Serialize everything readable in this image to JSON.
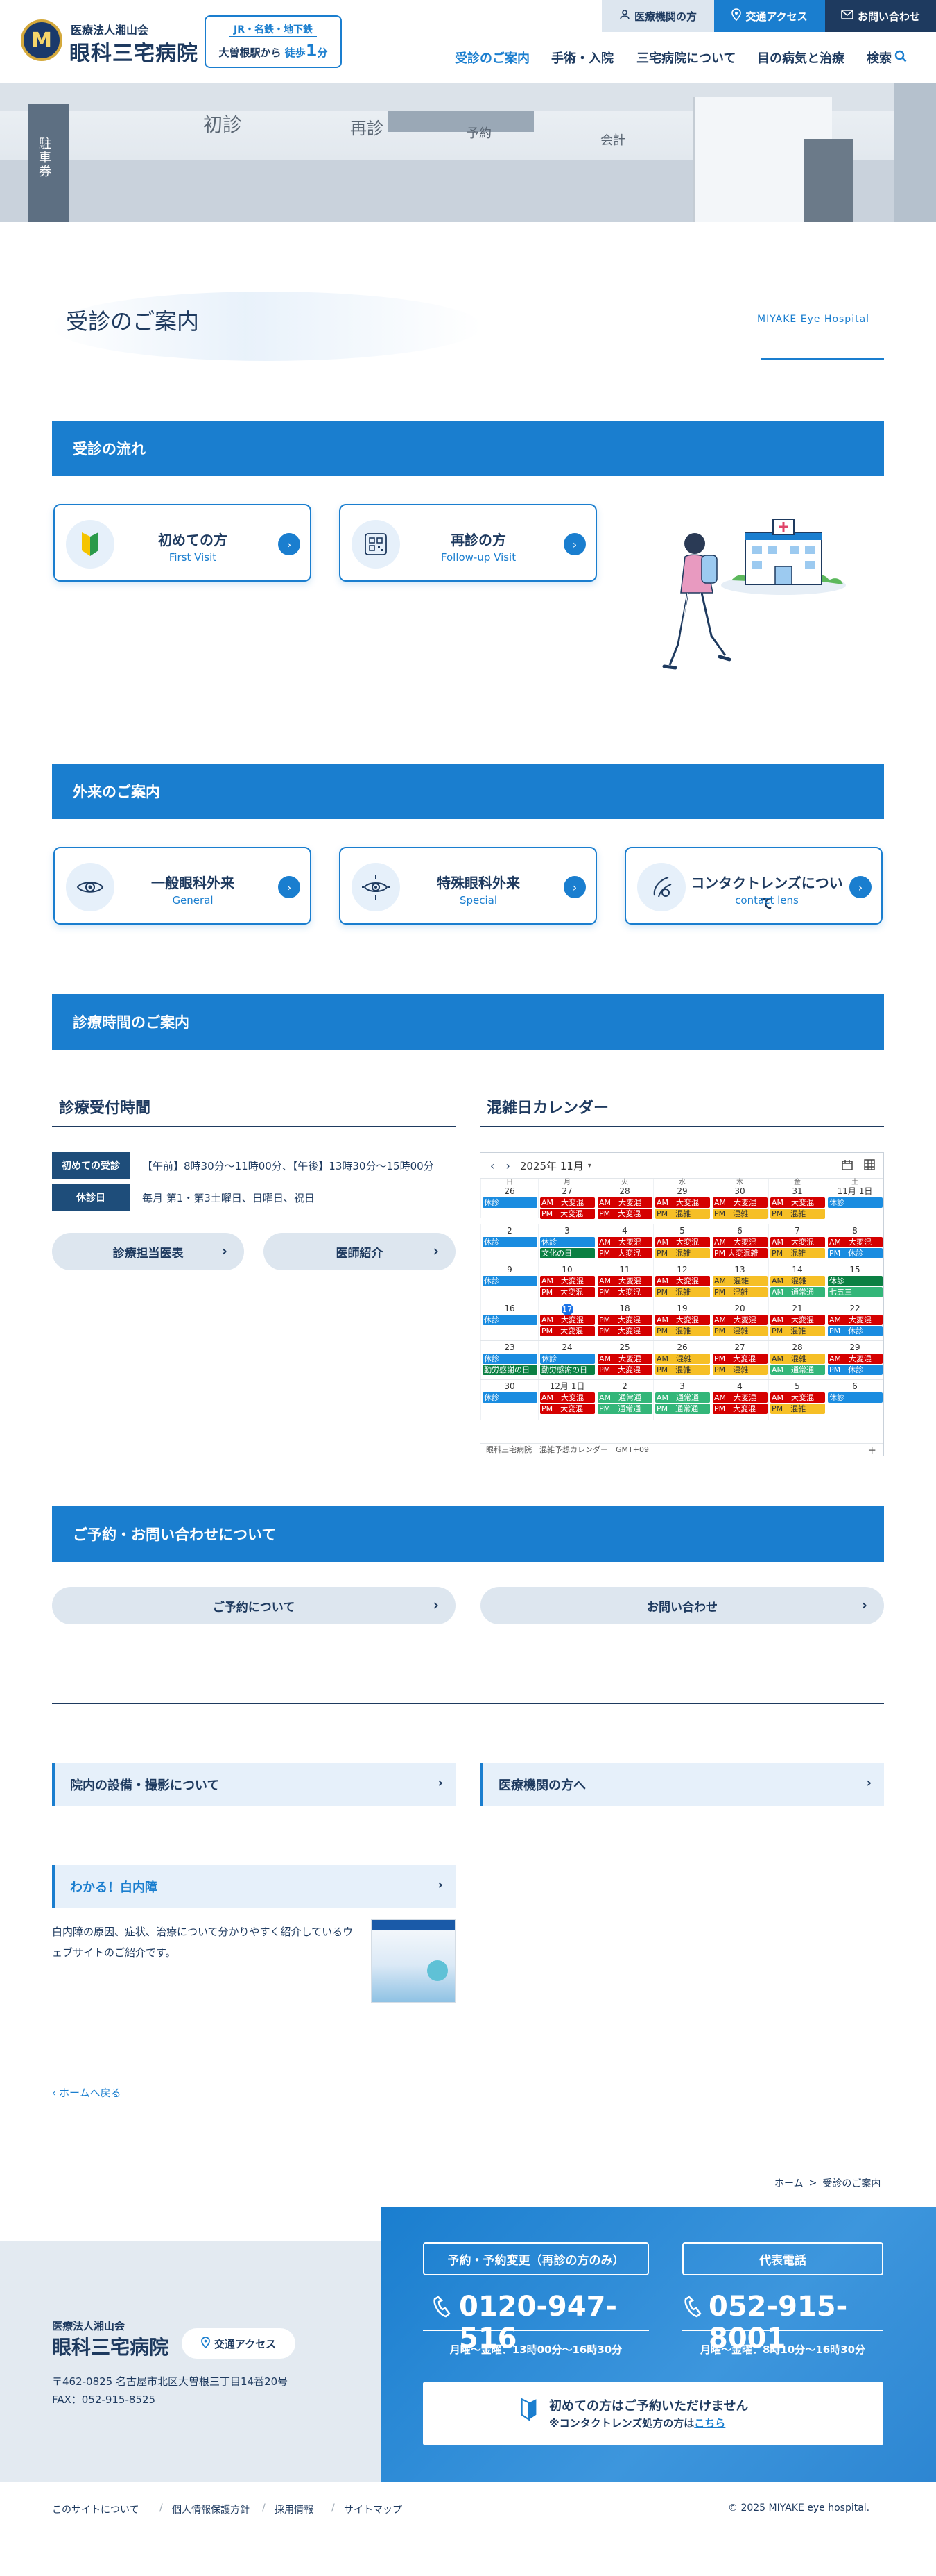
{
  "header": {
    "logo_letter": "M",
    "logo_sub": "医療法人湘山会",
    "logo_main": "眼科三宅病院",
    "access_line1": "JR・名鉄・地下鉄",
    "access_line2_pre": "大曽根駅から",
    "access_line2_walk": "徒歩",
    "access_line2_num": "1",
    "access_line2_unit": "分",
    "top_buttons": [
      "医療機関の方",
      "交通アクセス",
      "お問い合わせ"
    ],
    "nav": [
      "受診のご案内",
      "手術・入院",
      "三宅病院について",
      "目の病気と治療",
      "検索"
    ]
  },
  "hero": {
    "signs": [
      "初診",
      "再診",
      "予約",
      "会計"
    ],
    "board": "駐車券"
  },
  "page": {
    "title": "受診のご案内",
    "title_en": "MIYAKE Eye Hospital"
  },
  "flow": {
    "heading": "受診の流れ",
    "cards": [
      {
        "title": "初めての方",
        "sub": "First Visit"
      },
      {
        "title": "再診の方",
        "sub": "Follow-up Visit"
      }
    ]
  },
  "outpatient": {
    "heading": "外来のご案内",
    "cards": [
      {
        "title": "一般眼科外来",
        "sub": "General"
      },
      {
        "title": "特殊眼科外来",
        "sub": "Special"
      },
      {
        "title": "コンタクトレンズについて",
        "sub": "contact lens"
      }
    ]
  },
  "hours": {
    "heading": "診療時間のご案内",
    "reception_heading": "診療受付時間",
    "calendar_heading": "混雑日カレンダー",
    "rows": [
      {
        "tag": "初めての受診",
        "text": "【午前】8時30分〜11時00分、【午後】13時30分〜15時00分"
      },
      {
        "tag": "休診日",
        "text": "毎月 第1・第3土曜日、日曜日、祝日"
      }
    ],
    "buttons": [
      "診療担当医表",
      "医師紹介"
    ]
  },
  "calendar": {
    "month": "2025年 11月",
    "weekdays": [
      "日",
      "月",
      "火",
      "水",
      "木",
      "金",
      "土"
    ],
    "footer_left": "眼科三宅病院　混雑予想カレンダー　GMT+09",
    "footer_plus": "+",
    "weeks": [
      [
        {
          "d": "26",
          "ev": [
            [
              "blue",
              "休診"
            ]
          ]
        },
        {
          "d": "27",
          "ev": [
            [
              "red",
              "AM　大変混"
            ],
            [
              "red",
              "PM　大変混"
            ]
          ]
        },
        {
          "d": "28",
          "ev": [
            [
              "red",
              "AM　大変混"
            ],
            [
              "red",
              "PM　大変混"
            ]
          ]
        },
        {
          "d": "29",
          "ev": [
            [
              "red",
              "AM　大変混"
            ],
            [
              "yel",
              "PM　混雑"
            ]
          ]
        },
        {
          "d": "30",
          "ev": [
            [
              "red",
              "AM　大変混"
            ],
            [
              "yel",
              "PM　混雑"
            ]
          ]
        },
        {
          "d": "31",
          "ev": [
            [
              "red",
              "AM　大変混"
            ],
            [
              "yel",
              "PM　混雑"
            ]
          ]
        },
        {
          "d": "11月 1日",
          "ev": [
            [
              "blue",
              "休診"
            ]
          ]
        }
      ],
      [
        {
          "d": "2",
          "ev": [
            [
              "blue",
              "休診"
            ]
          ]
        },
        {
          "d": "3",
          "ev": [
            [
              "blue",
              "休診"
            ],
            [
              "grn",
              "文化の日"
            ]
          ]
        },
        {
          "d": "4",
          "ev": [
            [
              "red",
              "AM　大変混"
            ],
            [
              "red",
              "PM　大変混"
            ]
          ]
        },
        {
          "d": "5",
          "ev": [
            [
              "red",
              "AM　大変混"
            ],
            [
              "yel",
              "PM　混雑"
            ]
          ]
        },
        {
          "d": "6",
          "ev": [
            [
              "red",
              "AM　大変混"
            ],
            [
              "red",
              "PM 大変混雑"
            ]
          ]
        },
        {
          "d": "7",
          "ev": [
            [
              "red",
              "AM　大変混"
            ],
            [
              "yel",
              "PM　混雑"
            ]
          ]
        },
        {
          "d": "8",
          "ev": [
            [
              "red",
              "AM　大変混"
            ],
            [
              "blue",
              "PM　休診"
            ]
          ]
        }
      ],
      [
        {
          "d": "9",
          "ev": [
            [
              "blue",
              "休診"
            ]
          ]
        },
        {
          "d": "10",
          "ev": [
            [
              "red",
              "AM　大変混"
            ],
            [
              "red",
              "PM　大変混"
            ]
          ]
        },
        {
          "d": "11",
          "ev": [
            [
              "red",
              "AM　大変混"
            ],
            [
              "red",
              "PM　大変混"
            ]
          ]
        },
        {
          "d": "12",
          "ev": [
            [
              "red",
              "AM　大変混"
            ],
            [
              "yel",
              "PM　混雑"
            ]
          ]
        },
        {
          "d": "13",
          "ev": [
            [
              "yel",
              "AM　混雑"
            ],
            [
              "yel",
              "PM　混雑"
            ]
          ]
        },
        {
          "d": "14",
          "ev": [
            [
              "yel",
              "AM　混雑"
            ],
            [
              "teal",
              "AM　通常通"
            ]
          ]
        },
        {
          "d": "15",
          "ev": [
            [
              "grn",
              "休診"
            ],
            [
              "teal",
              "七五三"
            ]
          ]
        }
      ],
      [
        {
          "d": "16",
          "ev": [
            [
              "blue",
              "休診"
            ]
          ]
        },
        {
          "d": "17",
          "today": true,
          "ev": [
            [
              "red",
              "AM　大変混"
            ],
            [
              "red",
              "PM　大変混"
            ]
          ]
        },
        {
          "d": "18",
          "ev": [
            [
              "red",
              "PM　大変混"
            ],
            [
              "red",
              "PM　大変混"
            ]
          ]
        },
        {
          "d": "19",
          "ev": [
            [
              "red",
              "AM　大変混"
            ],
            [
              "yel",
              "PM　混雑"
            ]
          ]
        },
        {
          "d": "20",
          "ev": [
            [
              "red",
              "AM　大変混"
            ],
            [
              "yel",
              "PM　混雑"
            ]
          ]
        },
        {
          "d": "21",
          "ev": [
            [
              "red",
              "AM　大変混"
            ],
            [
              "yel",
              "PM　混雑"
            ]
          ]
        },
        {
          "d": "22",
          "ev": [
            [
              "red",
              "AM　大変混"
            ],
            [
              "blue",
              "PM　休診"
            ]
          ]
        }
      ],
      [
        {
          "d": "23",
          "ev": [
            [
              "blue",
              "休診"
            ],
            [
              "grn",
              "勤労感謝の日"
            ]
          ]
        },
        {
          "d": "24",
          "ev": [
            [
              "blue",
              "休診"
            ],
            [
              "grn",
              "勤労感謝の日"
            ]
          ]
        },
        {
          "d": "25",
          "ev": [
            [
              "red",
              "AM　大変混"
            ],
            [
              "red",
              "PM　大変混"
            ]
          ]
        },
        {
          "d": "26",
          "ev": [
            [
              "yel",
              "AM　混雑"
            ],
            [
              "yel",
              "PM　混雑"
            ]
          ]
        },
        {
          "d": "27",
          "ev": [
            [
              "red",
              "PM　大変混"
            ],
            [
              "yel",
              "PM　混雑"
            ]
          ]
        },
        {
          "d": "28",
          "ev": [
            [
              "yel",
              "AM　混雑"
            ],
            [
              "teal",
              "AM　通常通"
            ]
          ]
        },
        {
          "d": "29",
          "ev": [
            [
              "red",
              "AM　大変混"
            ],
            [
              "blue",
              "PM　休診"
            ]
          ]
        }
      ],
      [
        {
          "d": "30",
          "ev": [
            [
              "blue",
              "休診"
            ]
          ]
        },
        {
          "d": "12月 1日",
          "ev": [
            [
              "red",
              "AM　大変混"
            ],
            [
              "red",
              "PM　大変混"
            ]
          ]
        },
        {
          "d": "2",
          "ev": [
            [
              "teal",
              "AM　通常通"
            ],
            [
              "teal",
              "PM　通常通"
            ]
          ]
        },
        {
          "d": "3",
          "ev": [
            [
              "teal",
              "AM　通常通"
            ],
            [
              "teal",
              "PM　通常通"
            ]
          ]
        },
        {
          "d": "4",
          "ev": [
            [
              "red",
              "AM　大変混"
            ],
            [
              "red",
              "PM　大変混"
            ]
          ]
        },
        {
          "d": "5",
          "ev": [
            [
              "red",
              "AM　大変混"
            ],
            [
              "yel",
              "PM　混雑"
            ]
          ]
        },
        {
          "d": "6",
          "ev": [
            [
              "blue",
              "休診"
            ]
          ]
        }
      ]
    ]
  },
  "reservation": {
    "heading": "ご予約・お問い合わせについて",
    "buttons": [
      "ご予約について",
      "お問い合わせ"
    ]
  },
  "links": {
    "facility": "院内の設備・撮影について",
    "medical": "医療機関の方へ",
    "cataract_title": "わかる！白内障",
    "cataract_text": "白内障の原因、症状、治療について分かりやすく紹介しているウェブサイトのご紹介です。",
    "back_home": "ホームへ戻る"
  },
  "breadcrumb": [
    "ホーム",
    "受診のご案内"
  ],
  "footer": {
    "org": "医療法人湘山会",
    "name": "眼科三宅病院",
    "access_btn": "交通アクセス",
    "address": "〒462-0825 名古屋市北区大曽根三丁目14番20号",
    "fax": "FAX：052-915-8525",
    "reserve_label": "予約・予約変更（再診の方のみ）",
    "reserve_phone": "0120-947-516",
    "reserve_hours": "月曜〜金曜：13時00分〜16時30分",
    "main_label": "代表電話",
    "main_phone": "052-915-8001",
    "main_hours": "月曜〜金曜：8時10分〜16時30分",
    "first_line1": "初めての方はご予約いただけません",
    "first_line2_pre": "※コンタクトレンズ処方の方は",
    "first_line2_link": "こちら",
    "bottom_links": [
      "このサイトについて",
      "個人情報保護方針",
      "採用情報",
      "サイトマップ"
    ],
    "copyright": "© 2025  MIYAKE eye hospital."
  },
  "colors": {
    "primary": "#1a7ecf",
    "navy": "#1e3a5f",
    "light": "#e6f0fa"
  }
}
